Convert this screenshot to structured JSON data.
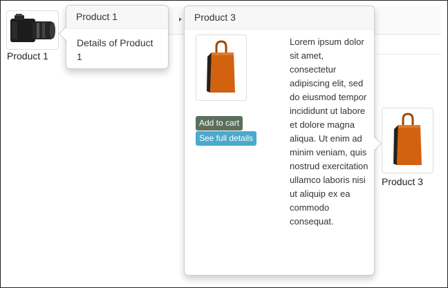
{
  "products": [
    {
      "caption": "Product 1",
      "image_icon": "camera-icon"
    },
    {
      "caption": "Product 3",
      "image_icon": "shopping-bag-icon"
    }
  ],
  "popover_product1": {
    "title": "Product 1",
    "body": "Details of Product 1"
  },
  "popover_product3": {
    "title": "Product 3",
    "description": "Lorem ipsum dolor sit amet, consectetur adipiscing elit, sed do eiusmod tempor incididunt ut labore et dolore magna aliqua. Ut enim ad minim veniam, quis nostrud exercitation ullamco laboris nisi ut aliquip ex ea commodo consequat.",
    "add_to_cart_label": "Add to cart",
    "see_details_label": "See full details",
    "image_icon": "shopping-bag-icon"
  },
  "colors": {
    "bag": "#d2620f",
    "add_to_cart_button": "#5b6f5d",
    "see_details_button": "#4ba9cd"
  }
}
